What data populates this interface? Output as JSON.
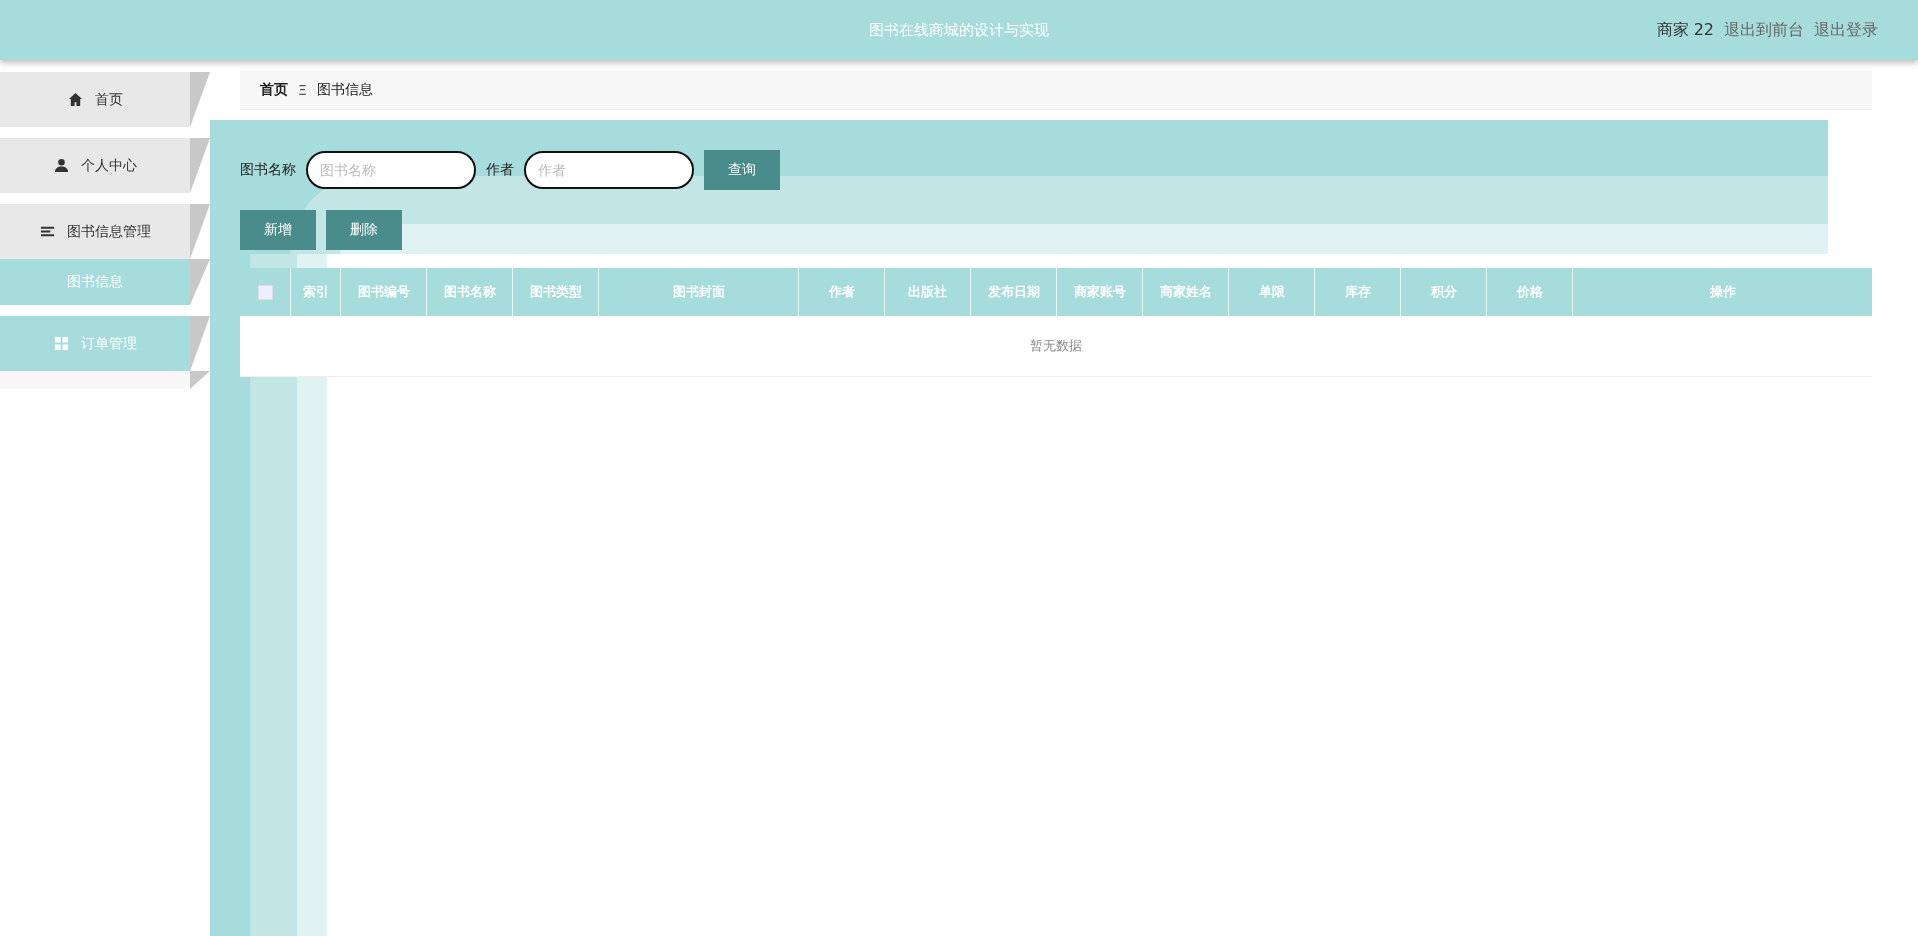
{
  "header": {
    "title": "图书在线商城的设计与实现",
    "user": "商家 22",
    "links": [
      "退出到前台",
      "退出登录"
    ]
  },
  "sidebar": {
    "items": [
      {
        "label": "首页",
        "highlighted": false
      },
      {
        "label": "个人中心",
        "highlighted": false
      },
      {
        "label": "图书信息管理",
        "highlighted": false,
        "children": [
          {
            "label": "图书信息",
            "selected": true
          }
        ]
      },
      {
        "label": "订单管理",
        "highlighted": true
      }
    ]
  },
  "breadcrumb": {
    "home": "首页",
    "separator": "Ξ",
    "current": "图书信息"
  },
  "search": {
    "fields": [
      {
        "label": "图书名称",
        "placeholder": "图书名称"
      },
      {
        "label": "作者",
        "placeholder": "作者"
      }
    ],
    "button": "查询"
  },
  "actions": [
    "新增",
    "删除"
  ],
  "table": {
    "select_all_checked": false,
    "columns": [
      "索引",
      "图书编号",
      "图书名称",
      "图书类型",
      "图书封面",
      "作者",
      "出版社",
      "发布日期",
      "商家账号",
      "商家姓名",
      "单限",
      "库存",
      "积分",
      "价格",
      "操作"
    ],
    "empty_text": "暂无数据"
  }
}
